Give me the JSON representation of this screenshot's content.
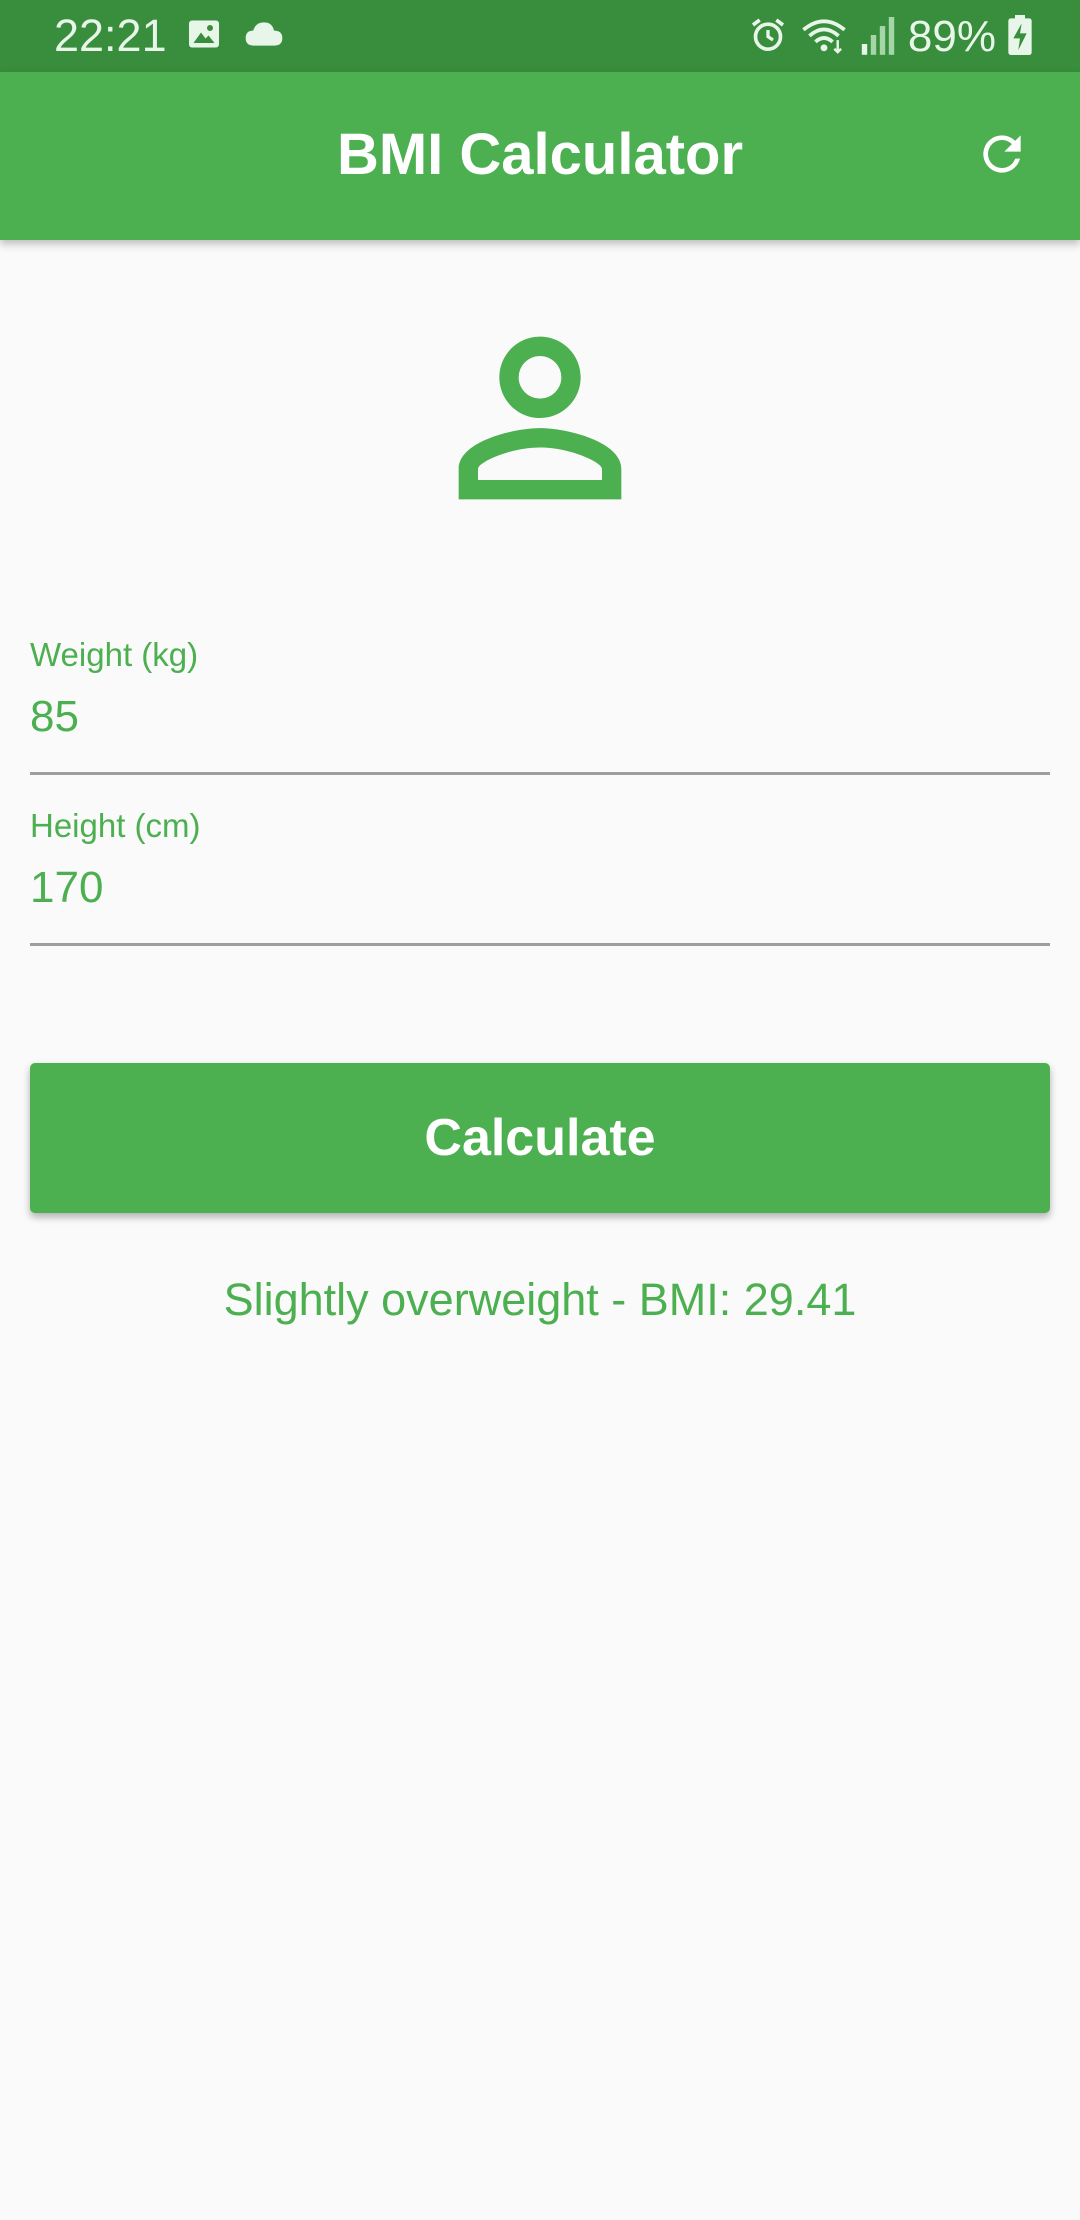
{
  "status_bar": {
    "time": "22:21",
    "battery": "89%",
    "left_icons": [
      "image-icon",
      "cloud-icon"
    ],
    "right_icons": [
      "alarm-icon",
      "wifi-icon",
      "signal-icon",
      "battery-charging-icon"
    ]
  },
  "app_bar": {
    "title": "BMI Calculator",
    "action_icon": "refresh-icon"
  },
  "header_icon": "person-outline-icon",
  "form": {
    "weight": {
      "label": "Weight (kg)",
      "value": "85"
    },
    "height": {
      "label": "Height (cm)",
      "value": "170"
    }
  },
  "button": {
    "label": "Calculate"
  },
  "result": {
    "text": "Slightly overweight - BMI: 29.41"
  },
  "colors": {
    "primary": "#4caf50",
    "primary_dark": "#388e3c",
    "background": "#fafafa",
    "underline": "#9e9e9e"
  }
}
